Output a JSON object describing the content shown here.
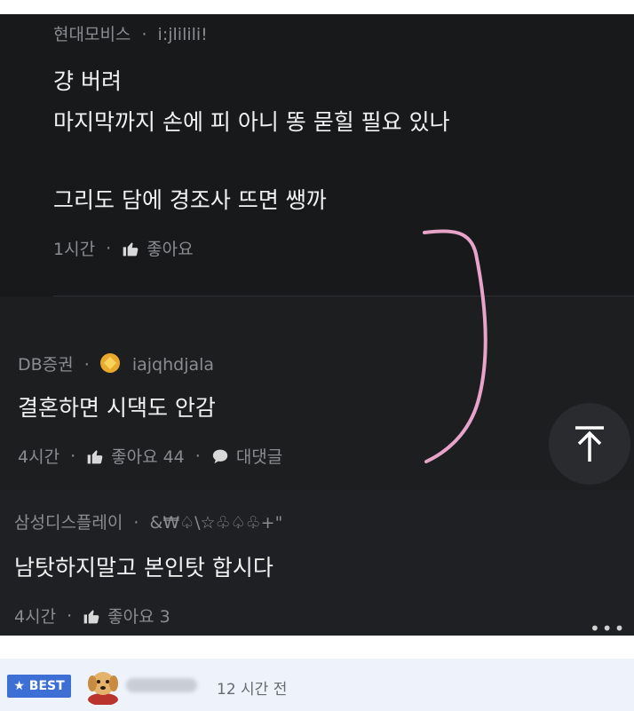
{
  "comments": [
    {
      "author": "현대모비스",
      "nickname": "i:jlilili!",
      "lines": [
        "걍 버려",
        "마지막까지 손에 피 아니 똥 묻힐 필요 있나",
        "그리도 담에 경조사 뜨면 쌩까"
      ],
      "time": "1시간",
      "like_label": "좋아요"
    },
    {
      "author": "DB증권",
      "nickname": "iajqhdjala",
      "lines": [
        "결혼하면 시댁도 안감"
      ],
      "time": "4시간",
      "like_label": "좋아요 44",
      "reply_label": "대댓글"
    },
    {
      "author": "삼성디스플레이",
      "nickname": "&₩♤\\☆♧♤♧+\"",
      "lines": [
        "남탓하지말고 본인탓 합시다"
      ],
      "time": "4시간",
      "like_label": "좋아요 3"
    }
  ],
  "separator": "·",
  "more": "•••",
  "bottom": {
    "badge": "★ BEST",
    "time": "12 시간 전"
  },
  "colors": {
    "background": "#18191b",
    "accent_annotation": "#e7a3c8",
    "best_badge": "#3d6fd4"
  },
  "icons": {
    "like": "thumbs-up-icon",
    "reply": "speech-bubble-icon",
    "scroll_top": "arrow-up-to-top-icon"
  }
}
